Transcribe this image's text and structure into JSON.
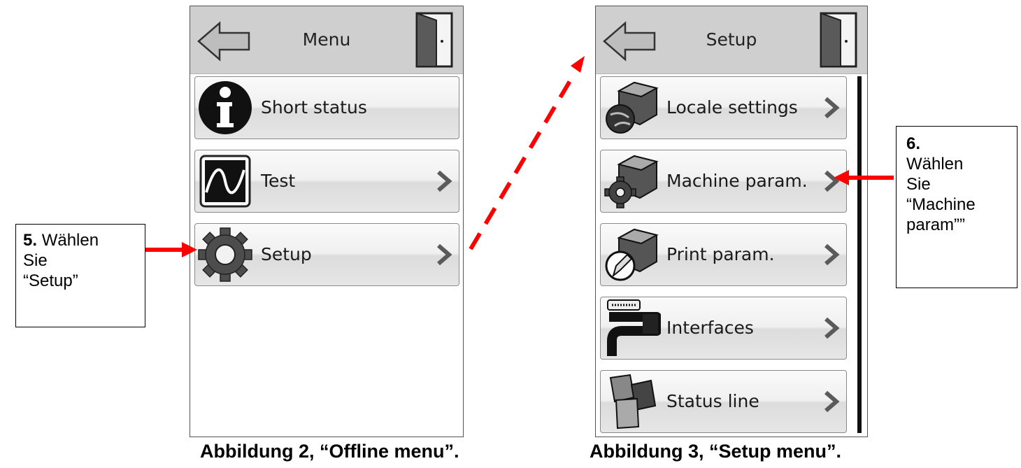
{
  "screens": {
    "menu": {
      "title": "Menu",
      "items": [
        {
          "label": "Short status",
          "icon": "info-icon",
          "has_chevron": false
        },
        {
          "label": "Test",
          "icon": "waveform-icon",
          "has_chevron": true
        },
        {
          "label": "Setup",
          "icon": "gear-icon",
          "has_chevron": true
        }
      ]
    },
    "setup": {
      "title": "Setup",
      "items": [
        {
          "label": "Locale settings",
          "icon": "globe-box-icon"
        },
        {
          "label": "Machine param.",
          "icon": "gear-box-icon"
        },
        {
          "label": "Print param.",
          "icon": "pen-box-icon"
        },
        {
          "label": "Interfaces",
          "icon": "connector-cable-icon"
        },
        {
          "label": "Status line",
          "icon": "status-tiles-icon"
        }
      ]
    }
  },
  "annotations": {
    "step5": {
      "number": "5.",
      "line1": "Wählen",
      "line2": "Sie",
      "line3": "“Setup”"
    },
    "step6": {
      "number": "6.",
      "line1": "Wählen",
      "line2": "Sie",
      "line3": "“Machine",
      "line4": "param””"
    }
  },
  "captions": {
    "fig2": "Abbildung 2, “Offline menu”.",
    "fig3": "Abbildung 3, “Setup menu”."
  },
  "colors": {
    "arrow": "#ff0000",
    "titlebar": "#cfcfcf",
    "frame": "#555555"
  }
}
